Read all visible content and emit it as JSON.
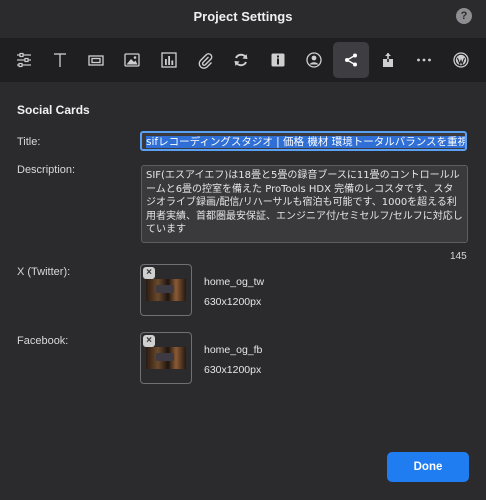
{
  "window": {
    "title": "Project Settings",
    "help_label": "?"
  },
  "toolbar": {
    "items": [
      {
        "icon": "sliders-icon"
      },
      {
        "icon": "text-icon"
      },
      {
        "icon": "frame-icon"
      },
      {
        "icon": "image-icon"
      },
      {
        "icon": "chart-icon"
      },
      {
        "icon": "paperclip-icon"
      },
      {
        "icon": "refresh-icon"
      },
      {
        "icon": "info-icon"
      },
      {
        "icon": "user-icon"
      },
      {
        "icon": "share-icon",
        "active": true
      },
      {
        "icon": "upload-icon"
      },
      {
        "icon": "more-icon"
      },
      {
        "icon": "wordpress-icon"
      }
    ]
  },
  "social_cards": {
    "heading": "Social Cards",
    "title_label": "Title:",
    "title_value": "sifレコーディングスタジオ | 価格 機材 環境トータルバランスを重視し",
    "description_label": "Description:",
    "description_value": "SIF(エスアイエフ)は18畳と5畳の録音ブースに11畳のコントロールルームと6畳の控室を備えた ProTools HDX 完備のレコスタです、スタジオライブ録画/配信/リハーサルも宿泊も可能です、1000を超える利用者実績、首都圏最安保証、エンジニア付/セミセルフ/セルフに対応しています",
    "description_count": "145",
    "twitter_label": "X (Twitter):",
    "twitter_image_name": "home_og_tw",
    "twitter_image_size": "630x1200px",
    "facebook_label": "Facebook:",
    "facebook_image_name": "home_og_fb",
    "facebook_image_size": "630x1200px",
    "remove_label": "×"
  },
  "footer": {
    "done_label": "Done"
  },
  "colors": {
    "accent": "#1f7cf1",
    "background": "#2b2b2d",
    "toolbar": "#1f1f21"
  }
}
